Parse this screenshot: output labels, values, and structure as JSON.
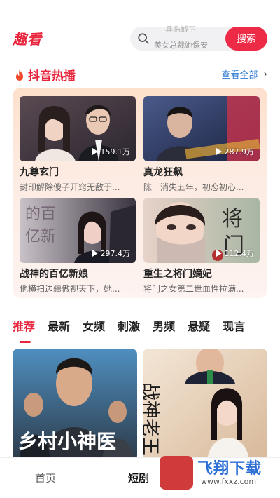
{
  "header": {
    "logo": "趣看",
    "search_hint_top": "兵临城下",
    "search_placeholder": "美女总裁她保安",
    "search_button": "搜索"
  },
  "hot_section": {
    "title": "抖音热播",
    "view_all": "查看全部",
    "cards": [
      {
        "title": "九尊玄门",
        "desc": "封印解除傻子开窍无敌于...",
        "plays": "159.1万"
      },
      {
        "title": "真龙狂飙",
        "desc": "陈一消失五年，初恋初心...",
        "plays": "287.9万"
      },
      {
        "title": "战神的百亿新娘",
        "desc": "他横扫边疆傲视天下，她...",
        "plays": "297.4万"
      },
      {
        "title": "重生之将门嫡妃",
        "desc": "将门之女第二世血性拉满...",
        "plays": "112.4万"
      }
    ]
  },
  "tabs": [
    "推荐",
    "最新",
    "女频",
    "刺激",
    "男频",
    "悬疑",
    "现言"
  ],
  "posters": [
    {
      "title": "乡村小神医"
    },
    {
      "title": "战神老王"
    }
  ],
  "bottom_nav": {
    "home": "首页",
    "short": "短剧"
  },
  "watermark": {
    "text": "飞翔下载",
    "url": "www.fxxz.com"
  }
}
